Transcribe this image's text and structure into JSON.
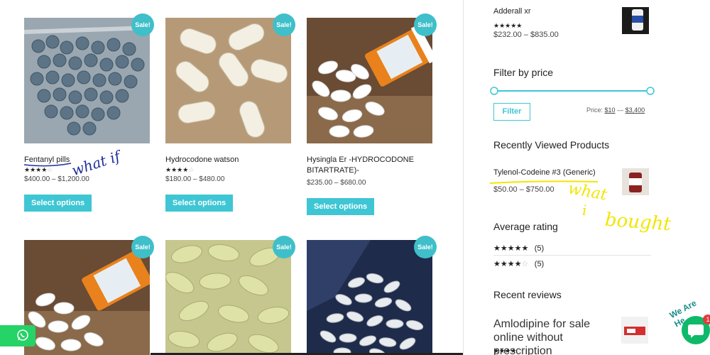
{
  "products": [
    {
      "name": "Fentanyl pills",
      "price": "$400.00 – $1,200.00",
      "rating": 3.5,
      "sale": "Sale!",
      "button": "Select options"
    },
    {
      "name": "Hydrocodone watson",
      "price": "$180.00 – $480.00",
      "rating": 4,
      "sale": "Sale!",
      "button": "Select options"
    },
    {
      "name": "Hysingla Er -HYDROCODONE BITARTRATE)-",
      "price": "$235.00 – $680.00",
      "rating": 0,
      "sale": "Sale!",
      "button": "Select options"
    },
    {
      "sale": "Sale!"
    },
    {
      "sale": "Sale!"
    },
    {
      "sale": "Sale!"
    }
  ],
  "sidebar": {
    "top_product": {
      "name": "Adderall xr",
      "price": "$232.00 – $835.00",
      "rating": 5
    },
    "filter_title": "Filter by price",
    "filter_button": "Filter",
    "price_label": "Price:",
    "price_min": "$10",
    "price_sep": "—",
    "price_max": "$3,400",
    "recent_title": "Recently Viewed Products",
    "recent_product": {
      "name": "Tylenol-Codeine #3 (Generic)",
      "price": "$50.00 – $750.00"
    },
    "avg_title": "Average rating",
    "ratings": [
      {
        "stars": 5,
        "count": "(5)"
      },
      {
        "stars": 4,
        "count": "(5)"
      }
    ],
    "reviews_title": "Recent reviews",
    "review_product": "Amlodipine for sale online without prescription"
  },
  "annotations": {
    "left": "what if",
    "right_1": "what",
    "right_2": "i",
    "right_3": "bought"
  },
  "widgets": {
    "help_text": "We Are He",
    "chat_badge": "1"
  },
  "colors": {
    "accent": "#3ec6d4",
    "annotation_blue": "#1e2f9a",
    "annotation_yellow": "#f2e600"
  }
}
